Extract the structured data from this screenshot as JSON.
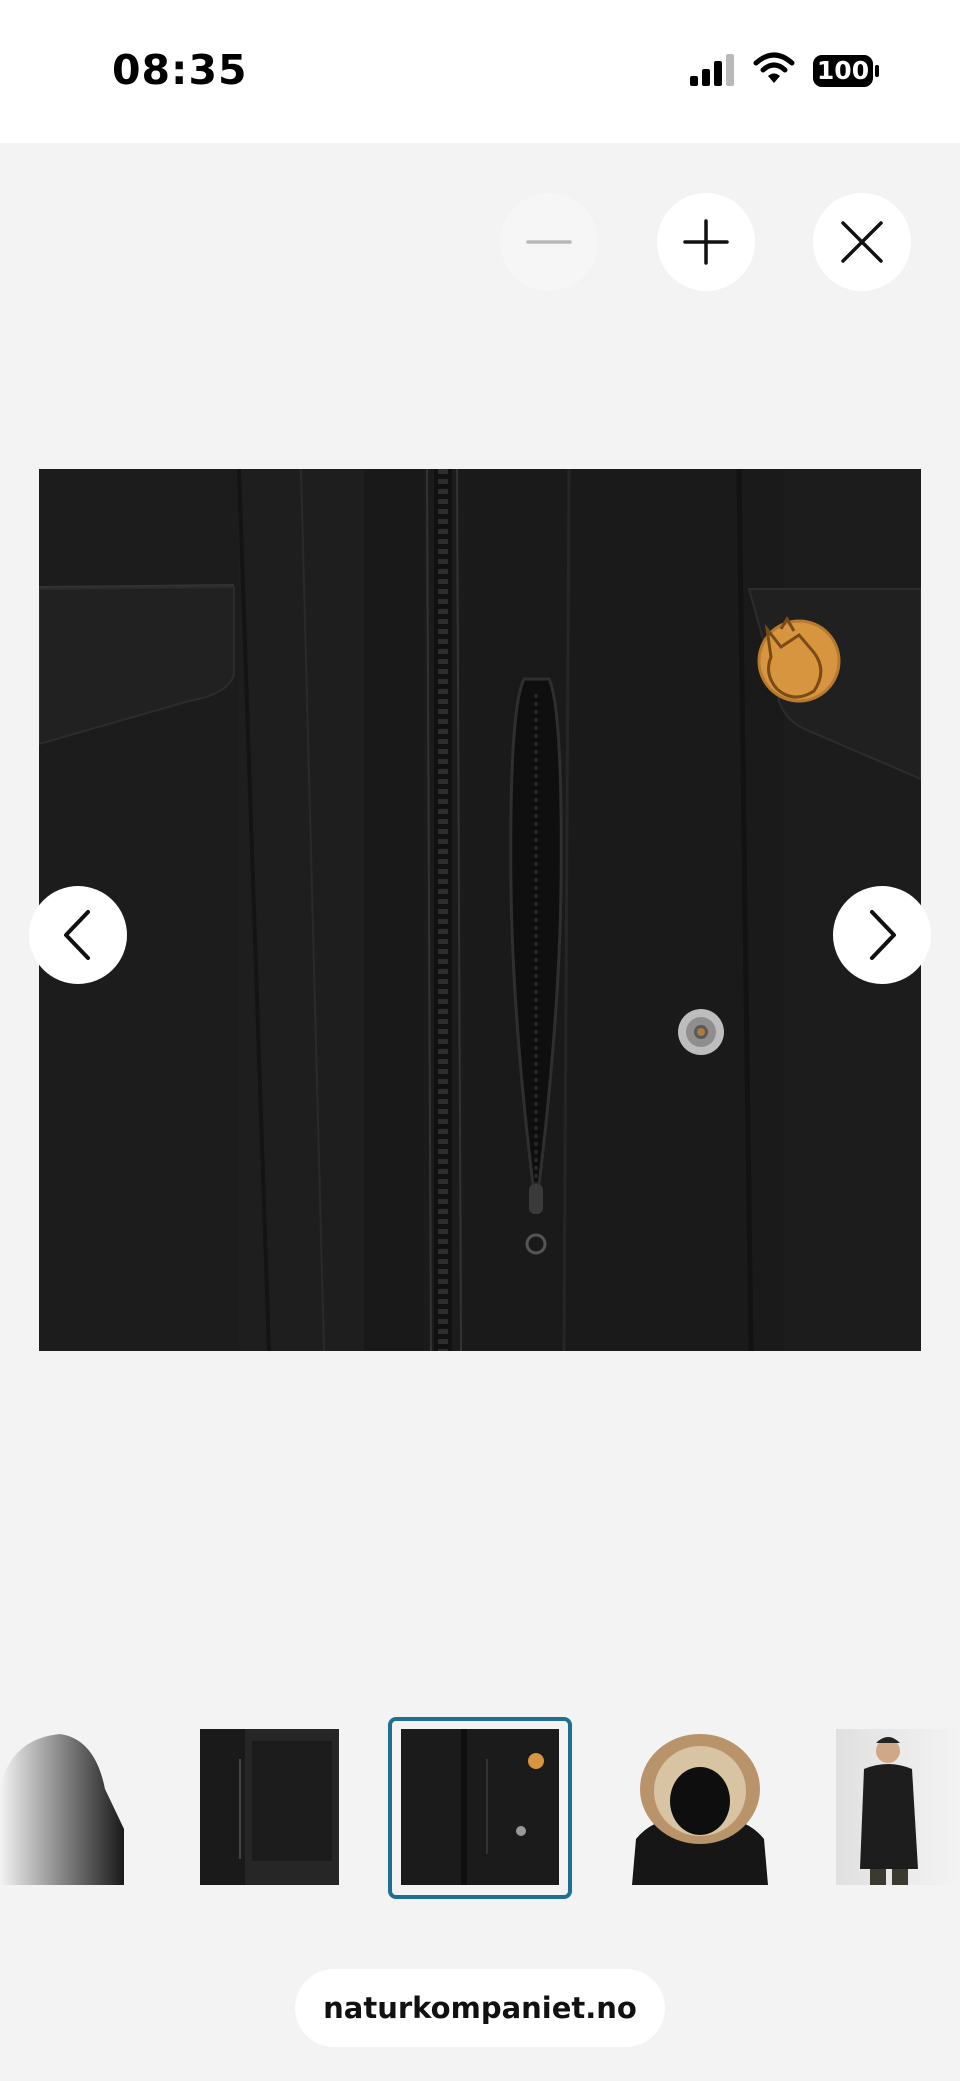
{
  "status_bar": {
    "time": "08:35",
    "battery": "100",
    "icons": [
      "signal-icon",
      "wifi-icon",
      "battery-icon"
    ]
  },
  "toolbar": {
    "zoom_out_icon": "minus-icon",
    "zoom_in_icon": "plus-icon",
    "close_icon": "close-icon",
    "zoom_out_enabled": false
  },
  "gallery": {
    "prev_icon": "chevron-left-icon",
    "next_icon": "chevron-right-icon",
    "selected_index": 2,
    "thumbnails": [
      {
        "name": "thumb-hood-back"
      },
      {
        "name": "thumb-inner-pocket"
      },
      {
        "name": "thumb-front-zipper-detail"
      },
      {
        "name": "thumb-fur-hood"
      },
      {
        "name": "thumb-model-wearing"
      }
    ]
  },
  "browser": {
    "url": "naturkompaniet.no"
  },
  "colors": {
    "background": "#f3f3f3",
    "selection_border": "#1f6f93",
    "patch_orange": "#d7953f"
  }
}
